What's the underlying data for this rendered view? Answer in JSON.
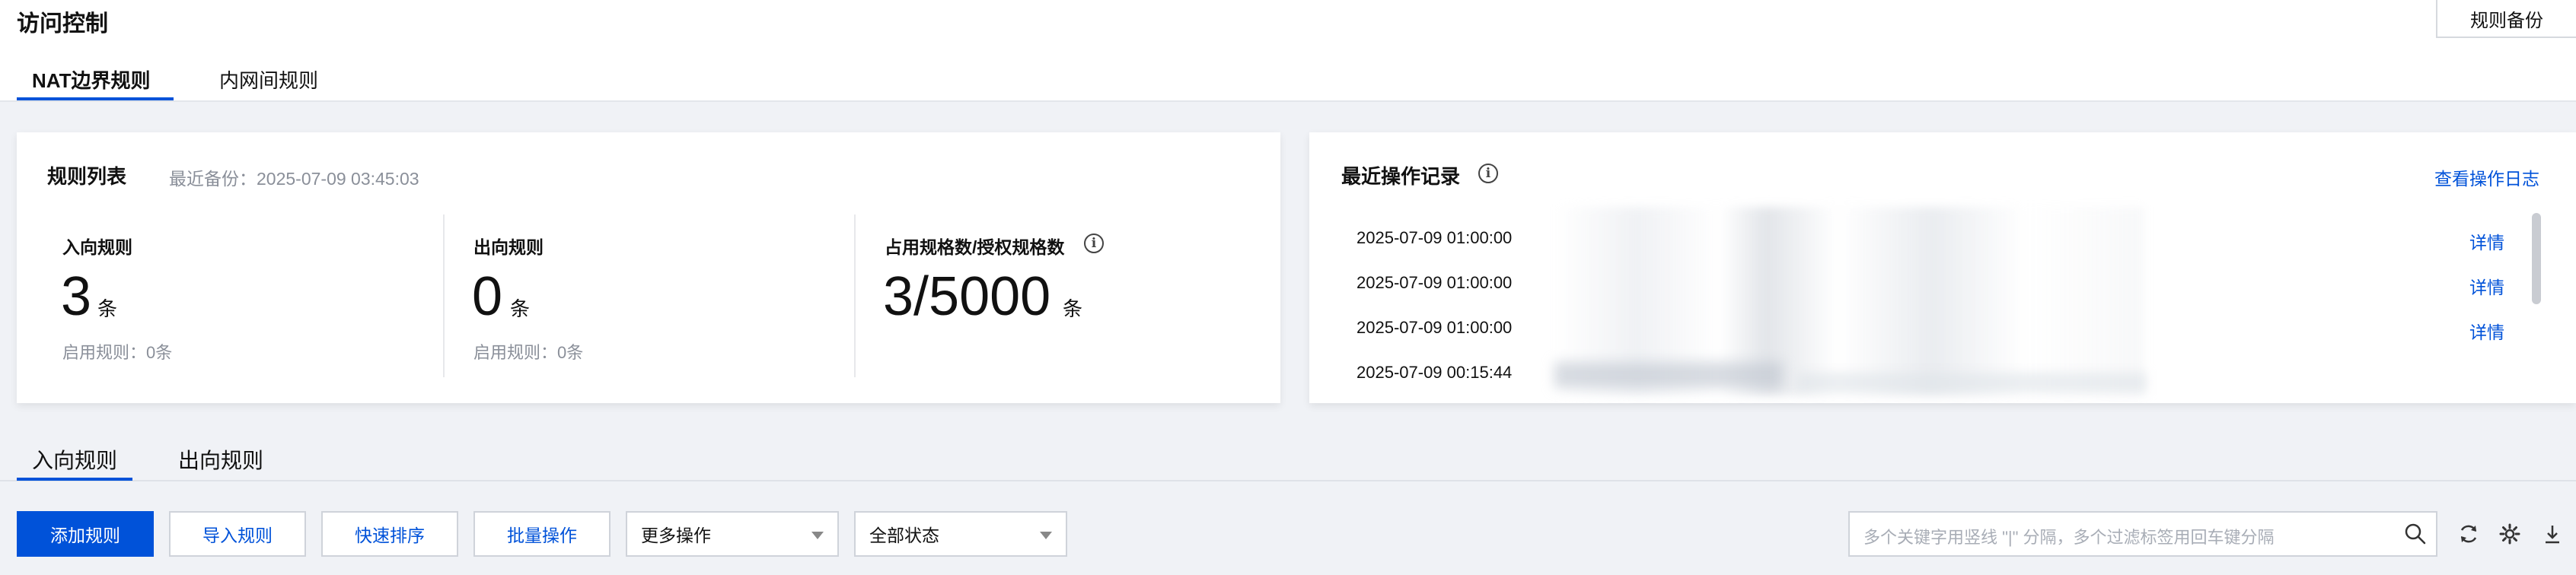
{
  "page": {
    "title": "访问控制",
    "backup_button": "规则备份",
    "tabs": [
      {
        "label": "NAT边界规则",
        "active": true
      },
      {
        "label": "内网间规则",
        "active": false
      }
    ]
  },
  "rule_list": {
    "title": "规则列表",
    "last_backup": "最近备份：2025-07-09 03:45:03",
    "stats": [
      {
        "label": "入向规则",
        "value": "3",
        "unit": "条",
        "sub": "启用规则：0条"
      },
      {
        "label": "出向规则",
        "value": "0",
        "unit": "条",
        "sub": "启用规则：0条"
      },
      {
        "label": "占用规格数/授权规格数",
        "value": "3/5000",
        "unit": "条"
      }
    ]
  },
  "recent_ops": {
    "title": "最近操作记录",
    "view_log": "查看操作日志",
    "entries": [
      {
        "time": "2025-07-09 01:00:00",
        "action": "详情"
      },
      {
        "time": "2025-07-09 01:00:00",
        "action": "详情"
      },
      {
        "time": "2025-07-09 01:00:00",
        "action": "详情"
      },
      {
        "time": "2025-07-09 00:15:44",
        "action": ""
      }
    ]
  },
  "rules_tabs": [
    {
      "label": "入向规则",
      "active": true
    },
    {
      "label": "出向规则",
      "active": false
    }
  ],
  "toolbar": {
    "add": "添加规则",
    "import": "导入规则",
    "quick_sort": "快速排序",
    "batch": "批量操作",
    "more_ops": "更多操作",
    "status": "全部状态",
    "search_placeholder": "多个关键字用竖线 \"|\" 分隔，多个过滤标签用回车键分隔"
  },
  "icons": {
    "search": "search-icon",
    "refresh": "refresh-icon",
    "settings": "gear-icon",
    "download": "download-icon",
    "info": "info-icon"
  },
  "colors": {
    "accent": "#0052d9",
    "background": "#f0f2f6"
  }
}
